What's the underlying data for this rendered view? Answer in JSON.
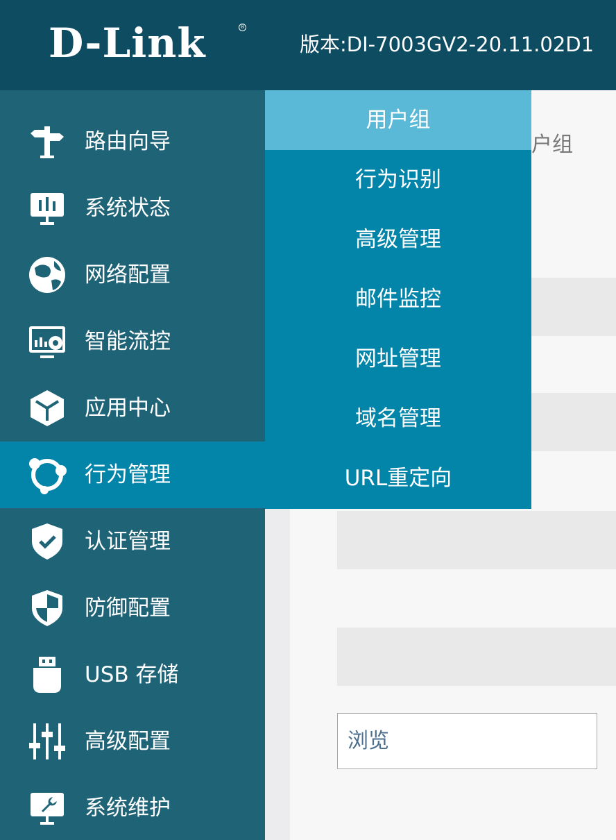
{
  "header": {
    "logo_text": "D-Link",
    "logo_reg": "®",
    "version_text": "版本:DI-7003GV2-20.11.02D1"
  },
  "sidebar": {
    "items": [
      {
        "label": "路由向导",
        "icon": "signpost-icon"
      },
      {
        "label": "系统状态",
        "icon": "monitor-chart-icon"
      },
      {
        "label": "网络配置",
        "icon": "globe-icon"
      },
      {
        "label": "智能流控",
        "icon": "dashboard-icon"
      },
      {
        "label": "应用中心",
        "icon": "cube-icon"
      },
      {
        "label": "行为管理",
        "icon": "network-nodes-icon",
        "active": true
      },
      {
        "label": "认证管理",
        "icon": "shield-check-icon"
      },
      {
        "label": "防御配置",
        "icon": "shield-icon"
      },
      {
        "label": "USB 存储",
        "icon": "usb-icon"
      },
      {
        "label": "高级配置",
        "icon": "sliders-icon"
      },
      {
        "label": "系统维护",
        "icon": "wrench-monitor-icon"
      }
    ]
  },
  "submenu": {
    "items": [
      {
        "label": "用户组",
        "selected": true
      },
      {
        "label": "行为识别"
      },
      {
        "label": "高级管理"
      },
      {
        "label": "邮件监控"
      },
      {
        "label": "网址管理"
      },
      {
        "label": "域名管理"
      },
      {
        "label": "URL重定向"
      }
    ]
  },
  "content": {
    "breadcrumb_partial": "户组",
    "browse_value": "浏览"
  },
  "colors": {
    "header_bg": "#0e4c62",
    "sidebar_bg": "#1f6377",
    "active_bg": "#0385a9",
    "submenu_selected_bg": "#5ab9d6"
  }
}
